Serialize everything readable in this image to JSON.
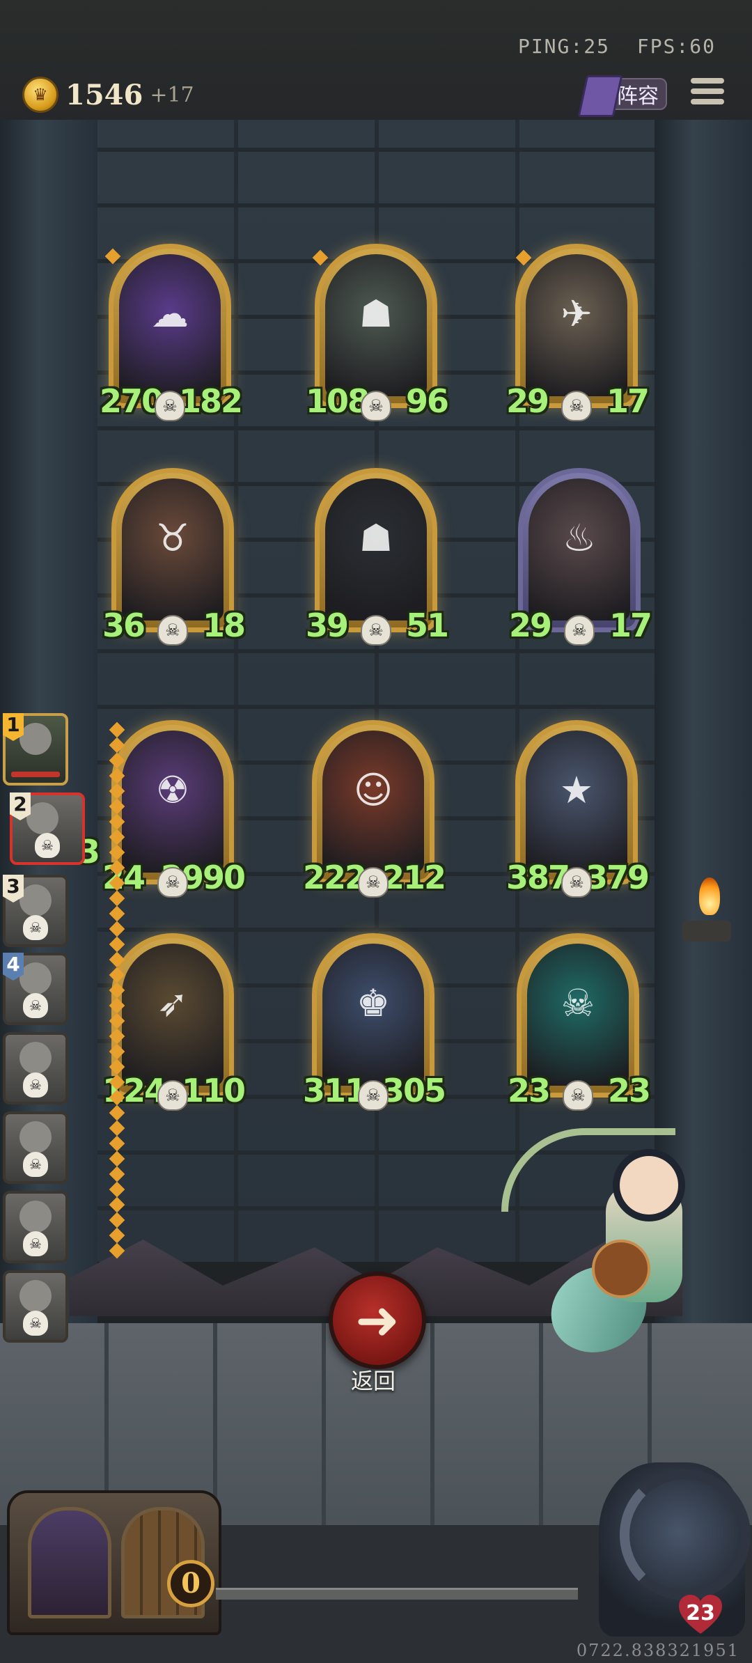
{
  "hud": {
    "ping": "PING:25",
    "fps": "FPS:60",
    "gold": "1546",
    "gold_delta": "+17",
    "lineup_label": "阵容"
  },
  "board": {
    "cards": [
      {
        "attack": "270",
        "health": "182",
        "name_icon": "ghost-woman",
        "art_color": "#5a3b8a"
      },
      {
        "attack": "108",
        "health": "96",
        "name_icon": "hooded-goblin",
        "art_color": "#4e5a52"
      },
      {
        "attack": "29",
        "health": "17",
        "name_icon": "rocket-ship",
        "art_color": "#6b6052"
      },
      {
        "attack": "36",
        "health": "18",
        "name_icon": "horned-ogre",
        "art_color": "#6a4a3a"
      },
      {
        "attack": "39",
        "health": "51",
        "name_icon": "shadow-reaper",
        "art_color": "#2a2f34"
      },
      {
        "attack": "29",
        "health": "17",
        "name_icon": "chef",
        "art_color": "#5a4a4c"
      },
      {
        "attack": "24",
        "health": "2990",
        "name_icon": "mad-scientist",
        "art_color": "#5a3c78"
      },
      {
        "attack": "222",
        "health": "212",
        "name_icon": "clown",
        "art_color": "#7a3a2a"
      },
      {
        "attack": "387",
        "health": "379",
        "name_icon": "wizard",
        "art_color": "#4a566e"
      },
      {
        "attack": "124",
        "health": "110",
        "name_icon": "archer-dwarf",
        "art_color": "#5a4a32"
      },
      {
        "attack": "311",
        "health": "305",
        "name_icon": "bearded-king",
        "art_color": "#3e4e6c"
      },
      {
        "attack": "23",
        "health": "23",
        "name_icon": "spectral-beast",
        "art_color": "#1f6b66"
      }
    ],
    "partial_left_value": "3"
  },
  "roster": {
    "slots": [
      {
        "number": "1",
        "state": "active"
      },
      {
        "number": "2",
        "state": "selected"
      },
      {
        "number": "3",
        "state": "dead"
      },
      {
        "number": "4",
        "state": "dead"
      },
      {
        "number": "",
        "state": "dead"
      },
      {
        "number": "",
        "state": "dead"
      },
      {
        "number": "",
        "state": "dead"
      },
      {
        "number": "",
        "state": "dead"
      }
    ]
  },
  "return_button": {
    "label": "返回",
    "icon": "arrow-left-icon"
  },
  "shop": {
    "count": "0"
  },
  "hero": {
    "health": "23"
  },
  "game_id": "0722.838321951",
  "colors": {
    "attack_badge": "#2f6aa8",
    "health_badge": "#b3312c",
    "stat_text": "#a7f07a",
    "card_gold": "#c99a3c"
  }
}
